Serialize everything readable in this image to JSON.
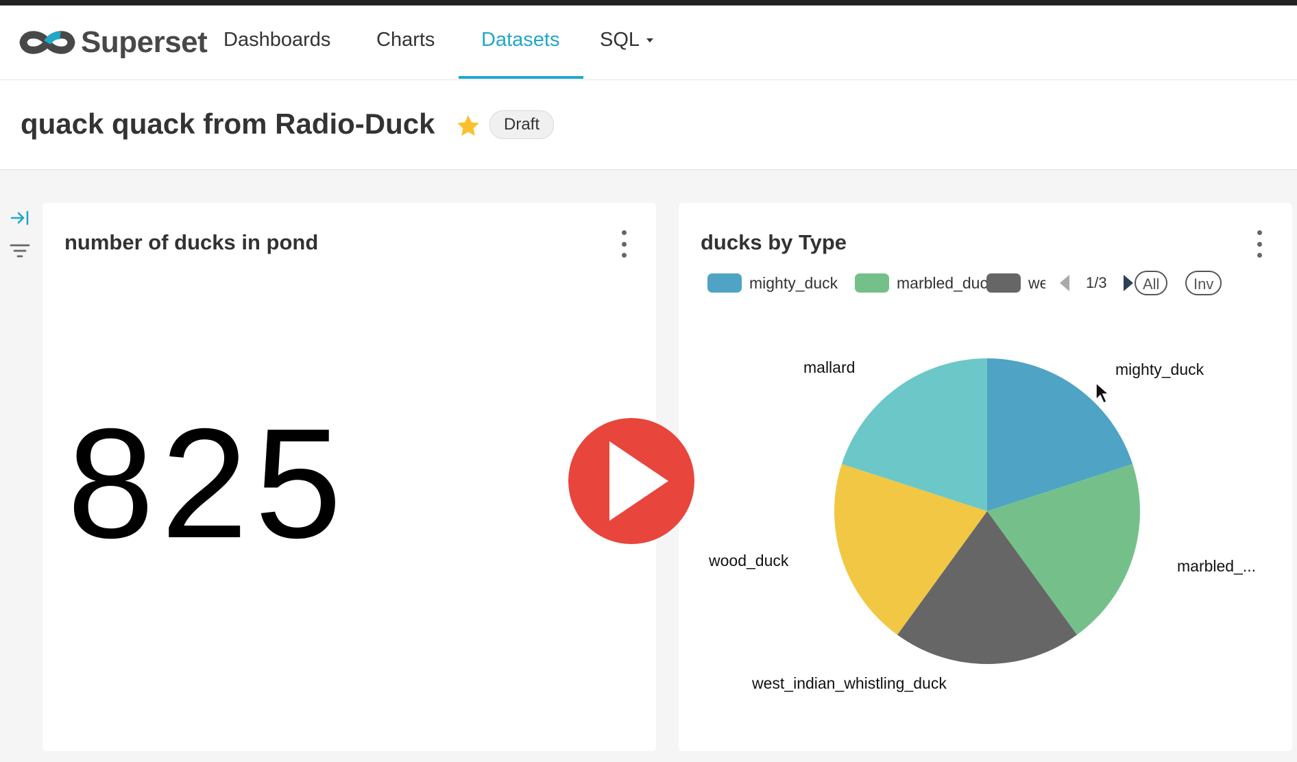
{
  "app": {
    "name": "Superset"
  },
  "nav": {
    "items": [
      {
        "label": "Dashboards",
        "active": false
      },
      {
        "label": "Charts",
        "active": false
      },
      {
        "label": "Datasets",
        "active": true
      },
      {
        "label": "SQL",
        "dropdown": true
      }
    ],
    "accent_color": "#20a7c9"
  },
  "dashboard": {
    "title": "quack quack from Radio-Duck",
    "favorite": true,
    "status": "Draft"
  },
  "side_icons": [
    "expand-right-icon",
    "filter-icon"
  ],
  "cards": [
    {
      "title": "number of ducks in pond",
      "big_number": "825"
    },
    {
      "title": "ducks by Type",
      "legend": {
        "items": [
          {
            "label": "mighty_duck",
            "color": "#4fa3c4"
          },
          {
            "label": "marbled_duck",
            "color": "#75c08a"
          },
          {
            "label": "wes",
            "color": "#666666"
          }
        ],
        "page": "1/3",
        "buttons": [
          "All",
          "Inv"
        ]
      }
    }
  ],
  "chart_data": {
    "type": "pie",
    "title": "ducks by Type",
    "slices": [
      {
        "name": "mighty_duck",
        "label": "mighty_duck",
        "value": 20,
        "color": "#4fa3c4"
      },
      {
        "name": "marbled_duck",
        "label": "marbled_...",
        "value": 20,
        "color": "#75c08a"
      },
      {
        "name": "west_indian_whistling_duck",
        "label": "west_indian_whistling_duck",
        "value": 20,
        "color": "#666666"
      },
      {
        "name": "wood_duck",
        "label": "wood_duck",
        "value": 20,
        "color": "#f2c744"
      },
      {
        "name": "mallard",
        "label": "mallard",
        "value": 20,
        "color": "#6cc7c8"
      }
    ]
  },
  "overlay": {
    "play_icon_color": "#e8453c"
  }
}
